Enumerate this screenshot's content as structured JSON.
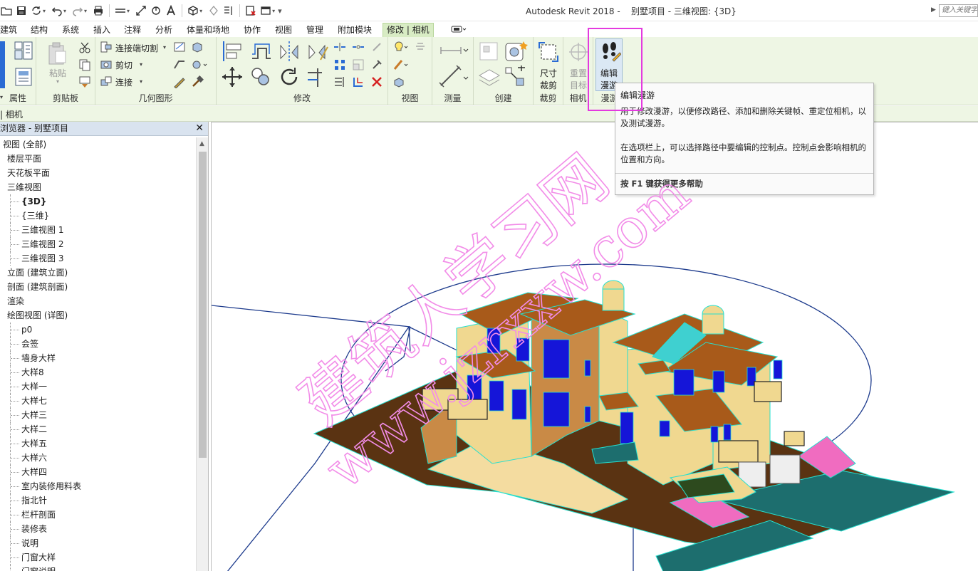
{
  "app": {
    "title": "Autodesk Revit 2018 -    别墅项目 - 三维视图: {3D}",
    "search_placeholder": "键入关键字"
  },
  "tabs": [
    {
      "label": "建筑"
    },
    {
      "label": "结构"
    },
    {
      "label": "系统"
    },
    {
      "label": "插入"
    },
    {
      "label": "注释"
    },
    {
      "label": "分析"
    },
    {
      "label": "体量和场地"
    },
    {
      "label": "协作"
    },
    {
      "label": "视图"
    },
    {
      "label": "管理"
    },
    {
      "label": "附加模块"
    },
    {
      "label": "修改 | 相机",
      "active": true
    }
  ],
  "ribbon": {
    "properties_label": "属性",
    "clipboard": {
      "label": "剪贴板",
      "paste": "粘贴"
    },
    "geometry": {
      "label": "几何图形",
      "cope": "连接端切割",
      "cut": "剪切",
      "join": "连接"
    },
    "modify_label": "修改",
    "view_label": "视图",
    "measure_label": "测量",
    "create_label": "创建",
    "crop": {
      "label": "裁剪",
      "size_line1": "尺寸",
      "size_line2": "裁剪"
    },
    "camera": {
      "label": "相机",
      "reset_line1": "重置",
      "reset_line2": "目标"
    },
    "walkthrough": {
      "label": "漫游",
      "edit_line1": "编辑",
      "edit_line2": "漫游"
    }
  },
  "options_bar": {
    "label": "| 相机"
  },
  "browser": {
    "title": "浏览器 - 别墅项目",
    "items": [
      {
        "label": "视图 (全部)",
        "indent": 0
      },
      {
        "label": "楼层平面",
        "indent": 1
      },
      {
        "label": "天花板平面",
        "indent": 1
      },
      {
        "label": "三维视图",
        "indent": 1
      },
      {
        "label": "{3D}",
        "indent": 2,
        "bold": true
      },
      {
        "label": "{三维}",
        "indent": 2
      },
      {
        "label": "三维视图 1",
        "indent": 2
      },
      {
        "label": "三维视图 2",
        "indent": 2
      },
      {
        "label": "三维视图 3",
        "indent": 2
      },
      {
        "label": "立面 (建筑立面)",
        "indent": 1
      },
      {
        "label": "剖面 (建筑剖面)",
        "indent": 1
      },
      {
        "label": "渲染",
        "indent": 1
      },
      {
        "label": "绘图视图 (详图)",
        "indent": 1
      },
      {
        "label": "p0",
        "indent": 2
      },
      {
        "label": "会签",
        "indent": 2
      },
      {
        "label": "墙身大样",
        "indent": 2
      },
      {
        "label": "大样8",
        "indent": 2
      },
      {
        "label": "大样一",
        "indent": 2
      },
      {
        "label": "大样七",
        "indent": 2
      },
      {
        "label": "大样三",
        "indent": 2
      },
      {
        "label": "大样二",
        "indent": 2
      },
      {
        "label": "大样五",
        "indent": 2
      },
      {
        "label": "大样六",
        "indent": 2
      },
      {
        "label": "大样四",
        "indent": 2
      },
      {
        "label": "室内装修用料表",
        "indent": 2
      },
      {
        "label": "指北针",
        "indent": 2
      },
      {
        "label": "栏杆剖面",
        "indent": 2
      },
      {
        "label": "装修表",
        "indent": 2
      },
      {
        "label": "说明",
        "indent": 2
      },
      {
        "label": "门窗大样",
        "indent": 2
      },
      {
        "label": "门窗说明",
        "indent": 2
      }
    ]
  },
  "tooltip": {
    "title": "编辑漫游",
    "description": "用于修改漫游，以便修改路径、添加和删除关键帧、重定位相机，以及测试漫游。",
    "description2": "在选项栏上，可以选择路径中要编辑的控制点。控制点会影响相机的位置和方向。",
    "help": "按 F1 键获得更多帮助"
  },
  "watermark": {
    "line1": "建筑人学习网",
    "line2": "www.jzrxxw.com",
    "color": "#f28ce8"
  },
  "colors": {
    "ribbon_bg": "#eef6e4",
    "active_tab": "#d8ecc4",
    "highlight": "#e43adf",
    "roof": "#a85a1a",
    "wall": "#f0d890",
    "outline": "#26e0d0",
    "window": "#1515d8",
    "ground": "#5a3312",
    "path": "#1c3a8c"
  }
}
